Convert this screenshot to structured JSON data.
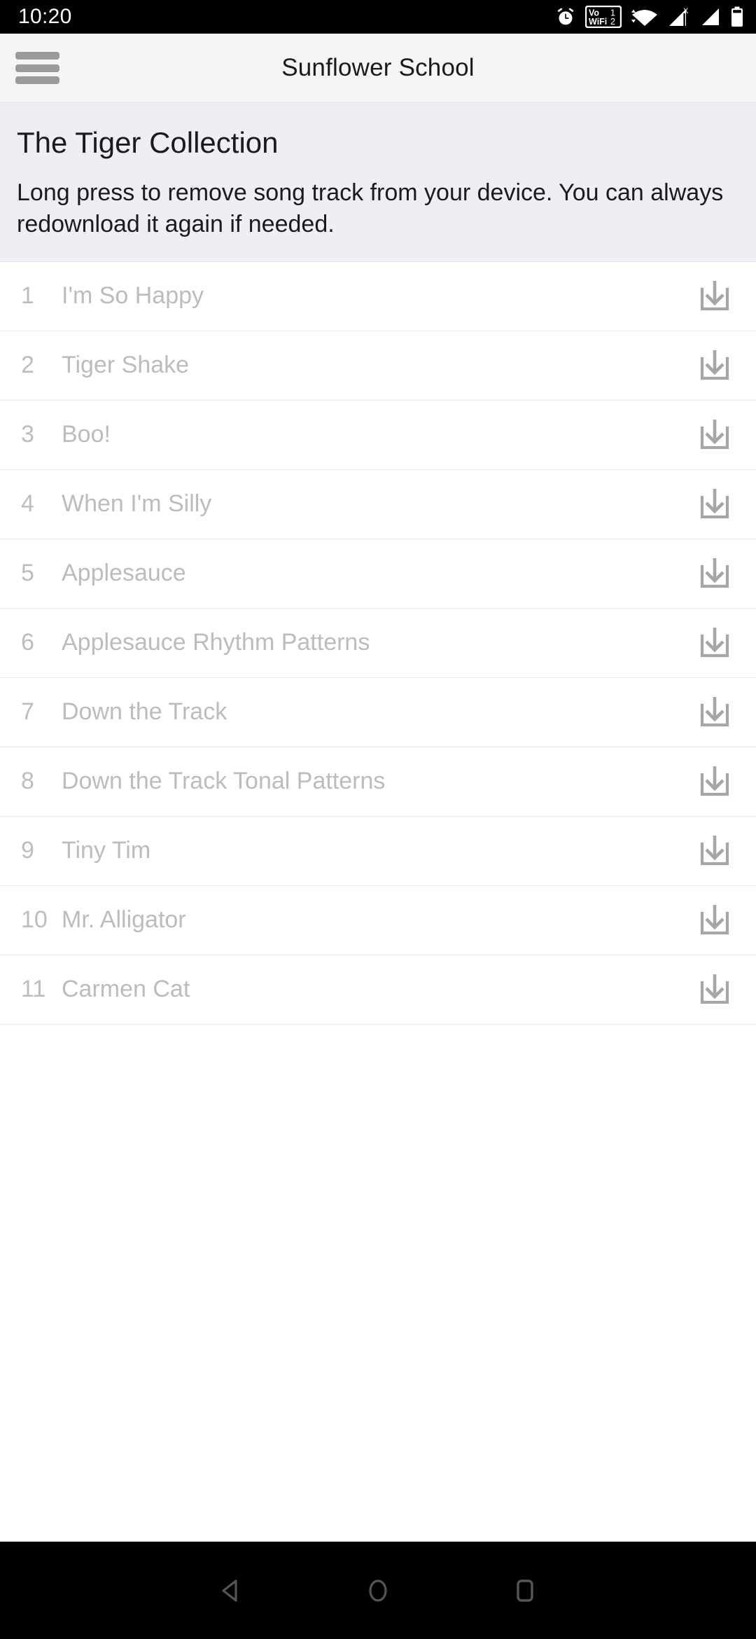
{
  "status_bar": {
    "time": "10:20",
    "icons": [
      {
        "name": "alarm-icon",
        "label": "Alarm set"
      },
      {
        "name": "vowifi-icon",
        "label": "VoWiFi 1 2"
      },
      {
        "name": "wifi-icon",
        "label": "Wi-Fi connected"
      },
      {
        "name": "signal-no-service-icon",
        "label": "Mobile signal X"
      },
      {
        "name": "signal-icon",
        "label": "Mobile signal"
      },
      {
        "name": "battery-icon",
        "label": "Battery"
      }
    ],
    "vowifi_text_top": "Vo",
    "vowifi_text_bottom": "WiFi",
    "vowifi_num_top": "1",
    "vowifi_num_bottom": "2",
    "signal_x_label": "X"
  },
  "app_bar": {
    "title": "Sunflower School",
    "menu_label": "Open navigation menu"
  },
  "collection": {
    "title": "The Tiger Collection",
    "description": "Long press to remove song track from your device. You can always redownload it again if needed."
  },
  "tracks": [
    {
      "number": "1",
      "title": "I'm So Happy",
      "action": "download"
    },
    {
      "number": "2",
      "title": "Tiger Shake",
      "action": "download"
    },
    {
      "number": "3",
      "title": "Boo!",
      "action": "download"
    },
    {
      "number": "4",
      "title": "When I'm Silly",
      "action": "download"
    },
    {
      "number": "5",
      "title": "Applesauce",
      "action": "download"
    },
    {
      "number": "6",
      "title": "Applesauce Rhythm Patterns",
      "action": "download"
    },
    {
      "number": "7",
      "title": "Down the Track",
      "action": "download"
    },
    {
      "number": "8",
      "title": "Down the Track Tonal Patterns",
      "action": "download"
    },
    {
      "number": "9",
      "title": "Tiny Tim",
      "action": "download"
    },
    {
      "number": "10",
      "title": "Mr. Alligator",
      "action": "download"
    },
    {
      "number": "11",
      "title": "Carmen Cat",
      "action": "download"
    }
  ],
  "nav_bar": {
    "back_label": "Back",
    "home_label": "Home",
    "recents_label": "Recent apps"
  },
  "colors": {
    "status_bar_bg": "#000000",
    "app_bar_bg": "#f5f5f5",
    "header_bg": "#eeeef4",
    "list_bg": "#ffffff",
    "track_text": "#bcbcbc",
    "divider": "#ececec",
    "icon_gray": "#9a9a9a",
    "nav_icon": "#555555",
    "title_text": "#1b1b1b"
  }
}
